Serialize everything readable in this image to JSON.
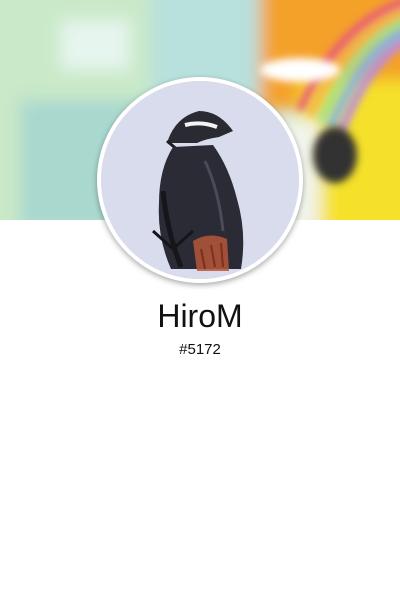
{
  "profile": {
    "username": "HiroM",
    "tag": "#5172"
  },
  "colors": {
    "background": "#ffffff",
    "text": "#111111",
    "avatar_ring": "#ffffff"
  },
  "icons": {
    "cover": "banner-image",
    "avatar": "ink-painting-figure"
  }
}
